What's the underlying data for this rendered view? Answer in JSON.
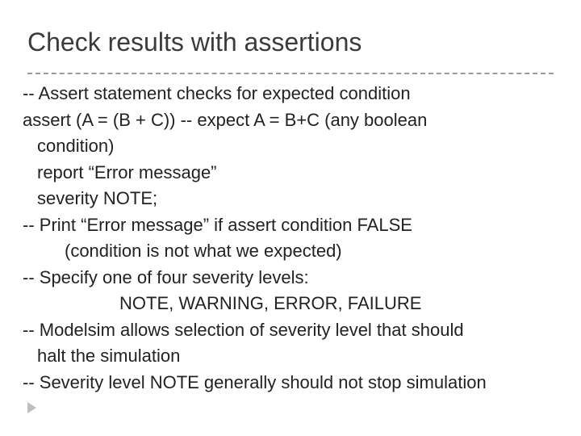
{
  "title": "Check results with assertions",
  "lines": {
    "l0": "-- Assert statement checks for expected condition",
    "l1": "assert (A = (B + C))  -- expect  A = B+C (any boolean",
    "l2": "condition)",
    "l3": "report “Error message”",
    "l4": "severity NOTE;",
    "l5": "-- Print “Error message” if assert condition FALSE",
    "l6": "(condition is not what we expected)",
    "l7": "-- Specify one of four severity levels:",
    "l8": "NOTE, WARNING,  ERROR, FAILURE",
    "l9": "-- Modelsim allows selection of severity level that should",
    "l10": "halt the simulation",
    "l11": "-- Severity level NOTE generally should not stop simulation"
  }
}
